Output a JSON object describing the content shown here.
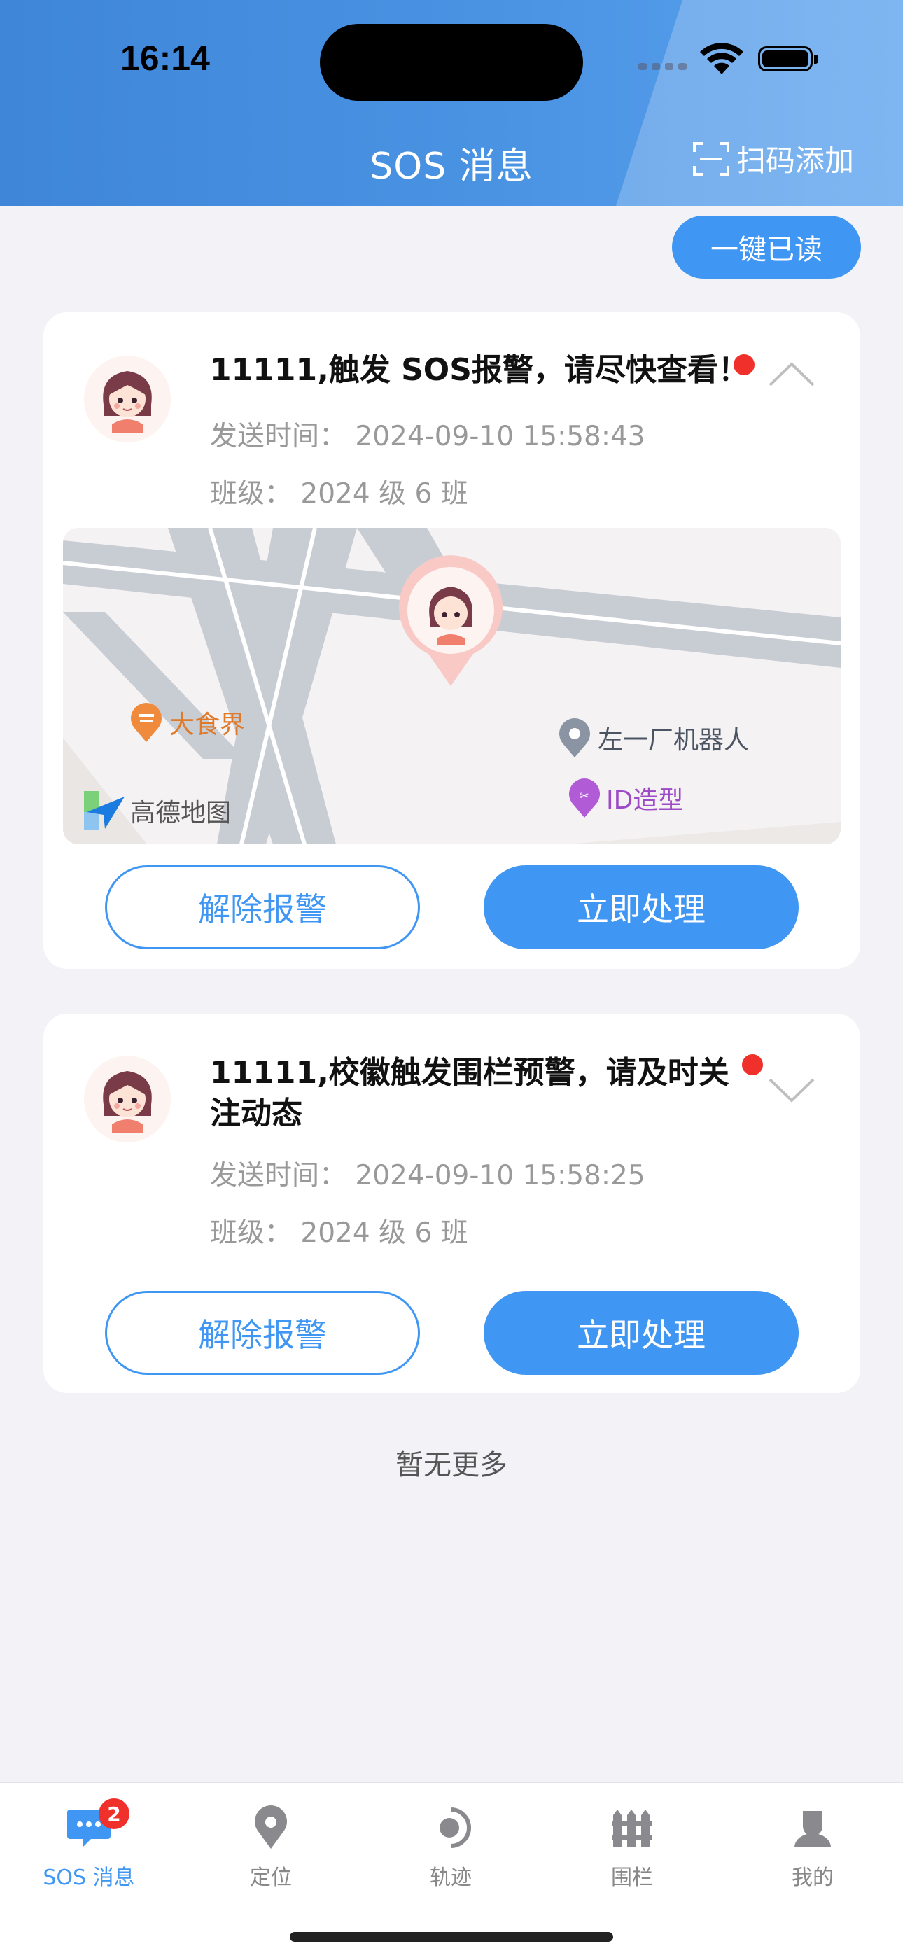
{
  "status_bar": {
    "time": "16:14"
  },
  "header": {
    "title": "SOS 消息",
    "scan_label": "扫码添加"
  },
  "mark_all_read": "一键已读",
  "messages": [
    {
      "title": "11111,触发 SOS报警，请尽快查看！",
      "send_time": "发送时间：  2024-09-10 15:58:43",
      "class_info": "班级：  2024 级 6 班",
      "expanded": true,
      "map": {
        "poi_1": "大食界",
        "poi_2": "左一厂机器人",
        "poi_3": "ID造型",
        "provider": "高德地图"
      },
      "dismiss_label": "解除报警",
      "handle_label": "立即处理"
    },
    {
      "title": "11111,校徽触发围栏预警，请及时关注动态",
      "send_time": "发送时间：  2024-09-10 15:58:25",
      "class_info": "班级：  2024 级 6 班",
      "expanded": false,
      "dismiss_label": "解除报警",
      "handle_label": "立即处理"
    }
  ],
  "no_more": "暂无更多",
  "tabbar": {
    "tabs": [
      {
        "label": "SOS 消息",
        "icon": "chat-bubble-icon",
        "active": true,
        "badge": "2"
      },
      {
        "label": "定位",
        "icon": "location-pin-icon",
        "active": false
      },
      {
        "label": "轨迹",
        "icon": "track-icon",
        "active": false
      },
      {
        "label": "围栏",
        "icon": "fence-icon",
        "active": false
      },
      {
        "label": "我的",
        "icon": "profile-icon",
        "active": false
      }
    ]
  },
  "colors": {
    "accent": "#3f96f3",
    "alert": "#f0312b",
    "header": "#4a93e3"
  }
}
